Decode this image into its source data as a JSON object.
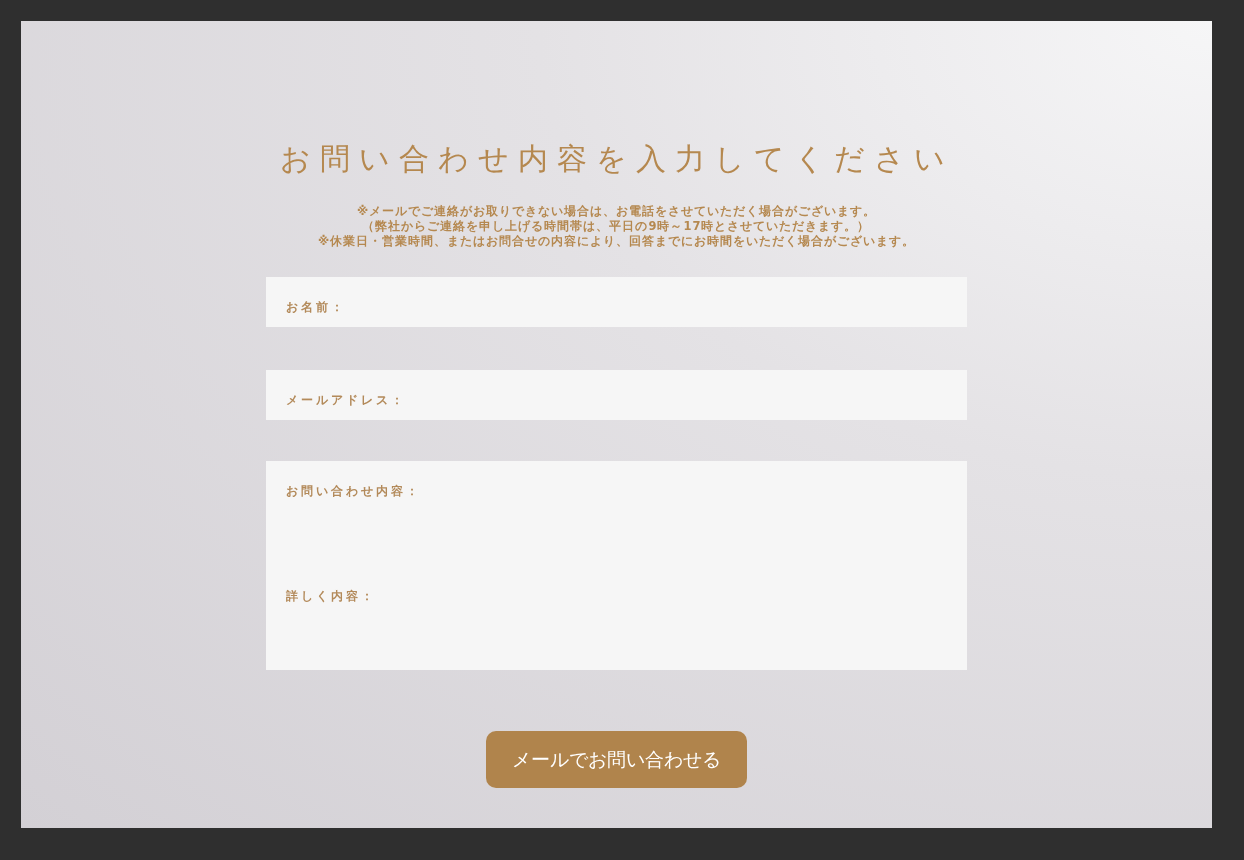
{
  "title": "お問い合わせ内容を入力してください",
  "notes": [
    "※メールでご連絡がお取りできない場合は、お電話をさせていただく場合がございます。",
    "（弊社からご連絡を申し上げる時間帯は、平日の9時～17時とさせていただきます。）",
    "※休業日・営業時間、またはお問合せの内容により、回答までにお時間をいただく場合がございます。"
  ],
  "fields": [
    {
      "label": "お名前：",
      "kind": "line"
    },
    {
      "label": "メールアドレス：",
      "kind": "line"
    },
    {
      "label": "お問い合わせ内容：",
      "kind": "joined"
    },
    {
      "label": "詳しく内容：",
      "kind": "area"
    }
  ],
  "submit": "メールでお問い合わせる"
}
